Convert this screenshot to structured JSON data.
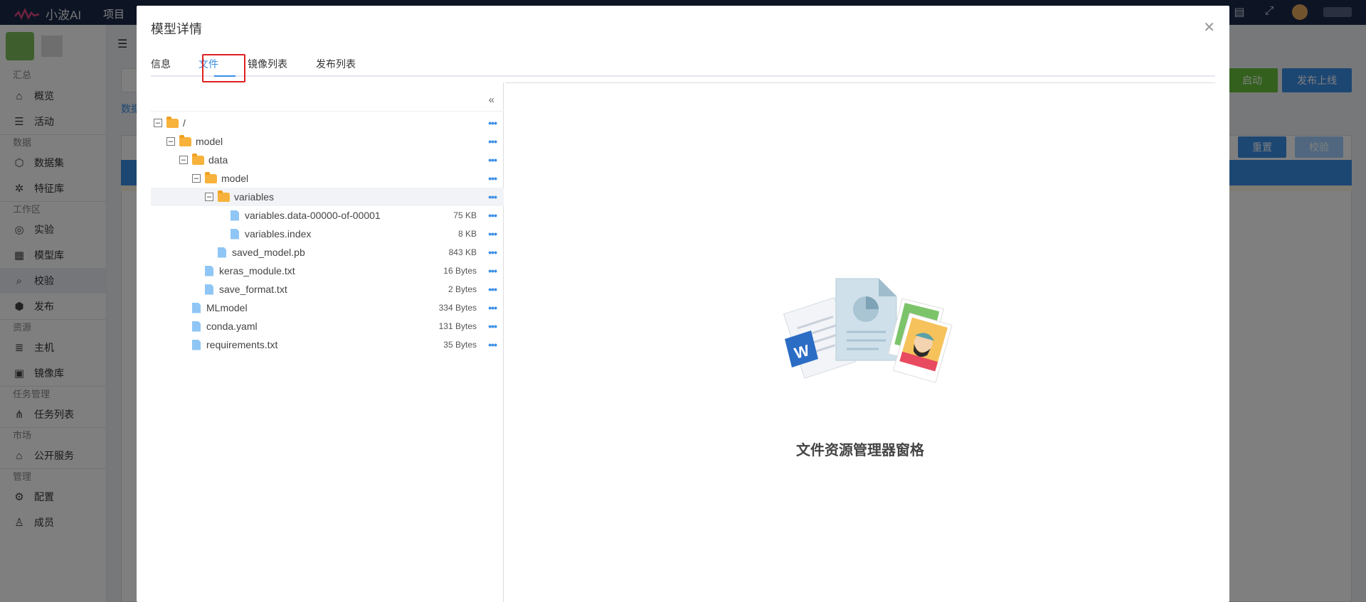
{
  "topbar": {
    "brand": "小波AI",
    "nav_project": "项目"
  },
  "sidebar": {
    "sections": [
      {
        "title": "汇总",
        "items": [
          {
            "label": "概览",
            "icon": "home-icon"
          },
          {
            "label": "活动",
            "icon": "activity-icon"
          }
        ]
      },
      {
        "title": "数据",
        "items": [
          {
            "label": "数据集",
            "icon": "cube-icon"
          },
          {
            "label": "特征库",
            "icon": "nodes-icon"
          }
        ]
      },
      {
        "title": "工作区",
        "items": [
          {
            "label": "实验",
            "icon": "experiment-icon"
          },
          {
            "label": "模型库",
            "icon": "model-store-icon"
          },
          {
            "label": "校验",
            "icon": "verify-icon",
            "active": true
          },
          {
            "label": "发布",
            "icon": "publish-icon"
          }
        ]
      },
      {
        "title": "资源",
        "items": [
          {
            "label": "主机",
            "icon": "server-icon"
          },
          {
            "label": "镜像库",
            "icon": "image-store-icon"
          }
        ]
      },
      {
        "title": "任务管理",
        "items": [
          {
            "label": "任务列表",
            "icon": "task-icon"
          }
        ]
      },
      {
        "title": "市场",
        "items": [
          {
            "label": "公开服务",
            "icon": "shop-icon"
          }
        ]
      },
      {
        "title": "管理",
        "items": [
          {
            "label": "配置",
            "icon": "gear-icon"
          },
          {
            "label": "成员",
            "icon": "user-icon"
          }
        ]
      }
    ]
  },
  "main": {
    "btn_start": "启动",
    "btn_publish": "发布上线",
    "btn_reset": "重置",
    "btn_check": "校验",
    "tab_data": "数据"
  },
  "modal": {
    "title": "模型详情",
    "tabs": [
      "信息",
      "文件",
      "镜像列表",
      "发布列表"
    ],
    "active_tab": "文件",
    "tree": [
      {
        "name": "/",
        "type": "folder",
        "depth": 0,
        "size": ""
      },
      {
        "name": "model",
        "type": "folder",
        "depth": 1,
        "size": ""
      },
      {
        "name": "data",
        "type": "folder",
        "depth": 2,
        "size": ""
      },
      {
        "name": "model",
        "type": "folder",
        "depth": 3,
        "size": ""
      },
      {
        "name": "variables",
        "type": "folder",
        "depth": 4,
        "size": "",
        "selected": true
      },
      {
        "name": "variables.data-00000-of-00001",
        "type": "file",
        "depth": 6,
        "size": "75 KB"
      },
      {
        "name": "variables.index",
        "type": "file",
        "depth": 6,
        "size": "8 KB"
      },
      {
        "name": "saved_model.pb",
        "type": "file",
        "depth": 5,
        "size": "843 KB"
      },
      {
        "name": "keras_module.txt",
        "type": "file",
        "depth": 4,
        "size": "16 Bytes"
      },
      {
        "name": "save_format.txt",
        "type": "file",
        "depth": 4,
        "size": "2 Bytes"
      },
      {
        "name": "MLmodel",
        "type": "file",
        "depth": 3,
        "size": "334 Bytes"
      },
      {
        "name": "conda.yaml",
        "type": "file",
        "depth": 3,
        "size": "131 Bytes"
      },
      {
        "name": "requirements.txt",
        "type": "file",
        "depth": 3,
        "size": "35 Bytes"
      }
    ],
    "preview_label": "文件资源管理器窗格"
  }
}
